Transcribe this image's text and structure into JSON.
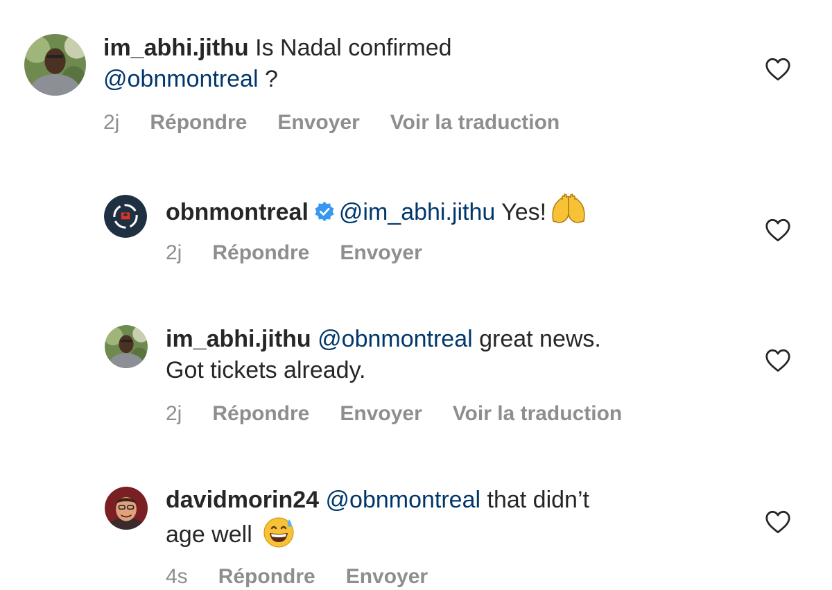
{
  "comments": [
    {
      "username": "im_abhi.jithu",
      "text_1": " Is Nadal confirmed",
      "mention": "@obnmontreal",
      "text_2": " ?",
      "time": "2j",
      "reply": "Répondre",
      "send": "Envoyer",
      "translate": "Voir la traduction"
    },
    {
      "username": "obnmontreal",
      "mention": "@im_abhi.jithu",
      "text": " Yes!",
      "emoji": "raising-hands",
      "time": "2j",
      "reply": "Répondre",
      "send": "Envoyer"
    },
    {
      "username": "im_abhi.jithu",
      "mention": "@obnmontreal",
      "text_1": " great news.",
      "text_2": "Got tickets already.",
      "time": "2j",
      "reply": "Répondre",
      "send": "Envoyer",
      "translate": "Voir la traduction"
    },
    {
      "username": "davidmorin24",
      "mention": "@obnmontreal",
      "text_1": " that didn’t",
      "text_2": "age well",
      "emoji": "grinning-face-with-sweat",
      "time": "4s",
      "reply": "Répondre",
      "send": "Envoyer"
    }
  ],
  "colors": {
    "text": "#262626",
    "mention": "#00376b",
    "meta": "#8e8e8e",
    "verified": "#3897f0"
  }
}
